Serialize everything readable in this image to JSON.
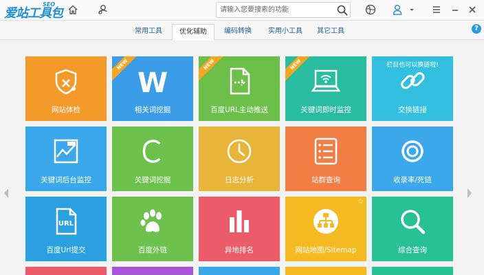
{
  "app": {
    "logo_text": "爱站工具包",
    "logo_sub": "SEO"
  },
  "search": {
    "placeholder": "请输入您要搜索的功能"
  },
  "tabs": [
    {
      "label": "常用工具",
      "active": false
    },
    {
      "label": "优化辅助",
      "active": true
    },
    {
      "label": "编码转换",
      "active": false
    },
    {
      "label": "实用小工具",
      "active": false
    },
    {
      "label": "其它工具",
      "active": false
    }
  ],
  "help": {
    "label": "?"
  },
  "tiles": [
    {
      "label": "网站体检",
      "color": "#f39a2b",
      "icon": "doctor-icon",
      "badge": ""
    },
    {
      "label": "相关词挖掘",
      "color": "#3b9de8",
      "icon": "w-icon",
      "badge": "NEW"
    },
    {
      "label": "百度URL主动推送",
      "color": "#6cc04a",
      "icon": "document-push-icon",
      "badge": "NEW"
    },
    {
      "label": "关键词即时监控",
      "color": "#28bca0",
      "icon": "monitor-icon",
      "badge": "NEW"
    },
    {
      "label": "交换链接",
      "color": "#33c0e0",
      "icon": "link-icon",
      "badge": "",
      "note": "栏目也可以换链啦!"
    },
    {
      "label": "关键词后台监控",
      "color": "#3aa8ea",
      "icon": "chart-icon",
      "badge": ""
    },
    {
      "label": "关键词挖掘",
      "color": "#6dc24e",
      "icon": "c-icon",
      "badge": ""
    },
    {
      "label": "日志分析",
      "color": "#e8b53a",
      "icon": "clock-icon",
      "badge": ""
    },
    {
      "label": "站群查询",
      "color": "#f07e45",
      "icon": "list-icon",
      "badge": ""
    },
    {
      "label": "收录率/死链",
      "color": "#3aa8ea",
      "icon": "ring-icon",
      "badge": ""
    },
    {
      "label": "百度Url提交",
      "color": "#2aa0e0",
      "icon": "url-icon",
      "badge": ""
    },
    {
      "label": "百度外链",
      "color": "#6dc24e",
      "icon": "paw-icon",
      "badge": ""
    },
    {
      "label": "异地排名",
      "color": "#ec5b6a",
      "icon": "bars-icon",
      "badge": ""
    },
    {
      "label": "网站地图/Sitemap",
      "color": "#f5b922",
      "icon": "sitemap-icon",
      "badge": "",
      "star": "☆"
    },
    {
      "label": "综合查询",
      "color": "#28c095",
      "icon": "magnifier-icon",
      "badge": ""
    }
  ],
  "partial_row_colors": [
    "#ec5b6a",
    "#a855d8",
    "#3aa8ea",
    "#f5b922",
    "#28c095"
  ]
}
